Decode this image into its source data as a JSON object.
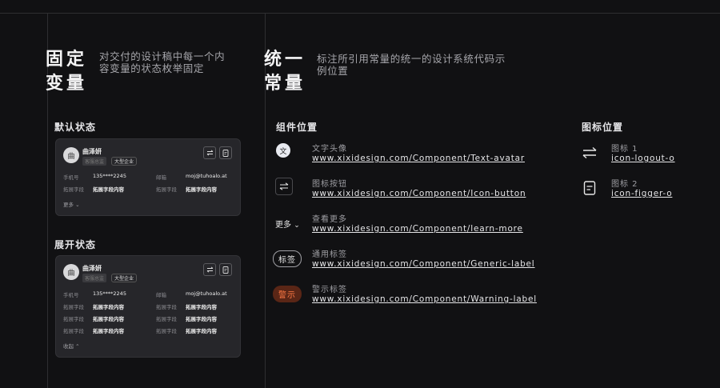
{
  "left_section": {
    "title": "固定变量",
    "description": "对交付的设计稿中每一个内容变量的状态枚举固定",
    "default_state": {
      "label": "默认状态",
      "card": {
        "avatar_text": "曲",
        "name": "曲泽妍",
        "tag_grey": "客服总监",
        "tag_outline": "大型企业",
        "fields": [
          {
            "label": "手机号",
            "value": "135****2245",
            "label2": "邮箱",
            "value2": "moj@tuhoalo.at"
          },
          {
            "label": "拓展字段",
            "value": "拓展字段内容",
            "label2": "拓展字段",
            "value2": "拓展字段内容"
          }
        ],
        "toggle": "更多"
      }
    },
    "expanded_state": {
      "label": "展开状态",
      "card": {
        "avatar_text": "曲",
        "name": "曲泽妍",
        "tag_grey": "客服总监",
        "tag_outline": "大型企业",
        "fields": [
          {
            "label": "手机号",
            "value": "135****2245",
            "label2": "邮箱",
            "value2": "moj@tuhoalo.at"
          },
          {
            "label": "拓展字段",
            "value": "拓展字段内容",
            "label2": "拓展字段",
            "value2": "拓展字段内容"
          },
          {
            "label": "拓展字段",
            "value": "拓展字段内容",
            "label2": "拓展字段",
            "value2": "拓展字段内容"
          },
          {
            "label": "拓展字段",
            "value": "拓展字段内容",
            "label2": "拓展字段",
            "value2": "拓展字段内容"
          }
        ],
        "toggle": "收起"
      }
    }
  },
  "right_section": {
    "title": "统一常量",
    "description": "标注所引用常量的统一的设计系统代码示例位置",
    "components_label": "组件位置",
    "components": [
      {
        "demo": "文",
        "name": "文字头像",
        "url": "www.xixidesign.com/Component/Text-avatar"
      },
      {
        "demo": "",
        "name": "图标按钮",
        "url": "www.xixidesign.com/Component/Icon-button"
      },
      {
        "demo": "更多",
        "name": "查看更多",
        "url": "www.xixidesign.com/Component/learn-more"
      },
      {
        "demo": "标签",
        "name": "通用标签",
        "url": "www.xixidesign.com/Component/Generic-label"
      },
      {
        "demo": "警示",
        "name": "警示标签",
        "url": "www.xixidesign.com/Component/Warning-label"
      }
    ],
    "icons_label": "图标位置",
    "icons": [
      {
        "icon": "swap-arrows-icon",
        "name": "图标 1",
        "code": "icon-logout-o"
      },
      {
        "icon": "document-icon",
        "name": "图标 2",
        "code": "icon-figger-o"
      }
    ]
  },
  "colors": {
    "background": "#111113",
    "card": "#26262a",
    "warning_text": "#ff7a45",
    "warning_bg": "#5a2616"
  }
}
